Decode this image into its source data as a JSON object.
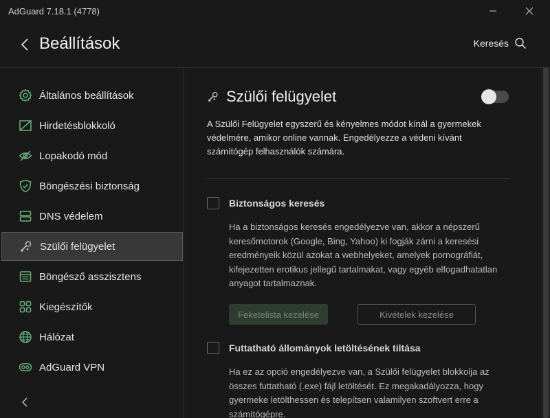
{
  "window": {
    "title": "AdGuard 7.18.1 (4778)"
  },
  "header": {
    "title": "Beállítások",
    "search_label": "Keresés"
  },
  "colors": {
    "accent_green": "#67b279",
    "background": "#191919",
    "active_item": "#383838"
  },
  "sidebar": {
    "items": [
      {
        "label": "Általános beállítások",
        "icon": "gear-icon"
      },
      {
        "label": "Hirdetésblokkoló",
        "icon": "ad-block-icon"
      },
      {
        "label": "Lopakodó mód",
        "icon": "eye-off-icon"
      },
      {
        "label": "Böngészési biztonság",
        "icon": "shield-check-icon"
      },
      {
        "label": "DNS védelem",
        "icon": "server-icon"
      },
      {
        "label": "Szülői felügyelet",
        "icon": "rattle-icon",
        "active": true
      },
      {
        "label": "Böngésző asszisztens",
        "icon": "browser-icon"
      },
      {
        "label": "Kiegészítők",
        "icon": "grid-icon"
      },
      {
        "label": "Hálózat",
        "icon": "globe-icon"
      },
      {
        "label": "AdGuard VPN",
        "icon": "vpn-icon"
      }
    ]
  },
  "content": {
    "title": "Szülői felügyelet",
    "enabled": false,
    "description": "A Szülői Felügyelet egyszerű és kényelmes módot kínál a gyermekek védelmére, amikor online vannak. Engedélyezze a védeni kívánt számítógép felhasználók számára.",
    "options": [
      {
        "title": "Biztonságos keresés",
        "checked": false,
        "description": "Ha a biztonságos keresés engedélyezve van, akkor a népszerű keresőmotorok (Google, Bing, Yahoo) ki fogják zárni a keresési eredményeik közül azokat a webhelyeket, amelyek pornográfiát, kifejezetten erotikus jellegű tartalmakat, vagy egyéb elfogadhatatlan anyagot tartalmaznak."
      },
      {
        "title": "Futtatható állományok letöltésének tiltása",
        "checked": false,
        "description": "Ha ez az opció engedélyezve van, a Szülői felügyelet blokkolja az összes futtatható (.exe) fájl letöltését. Ez megakadályozza, hogy gyermeke letölthessen és telepítsen valamilyen szoftvert erre a számítógépre."
      }
    ],
    "buttons": {
      "blacklist": "Feketelista kezelése",
      "exceptions": "Kivételek kezelése"
    }
  }
}
